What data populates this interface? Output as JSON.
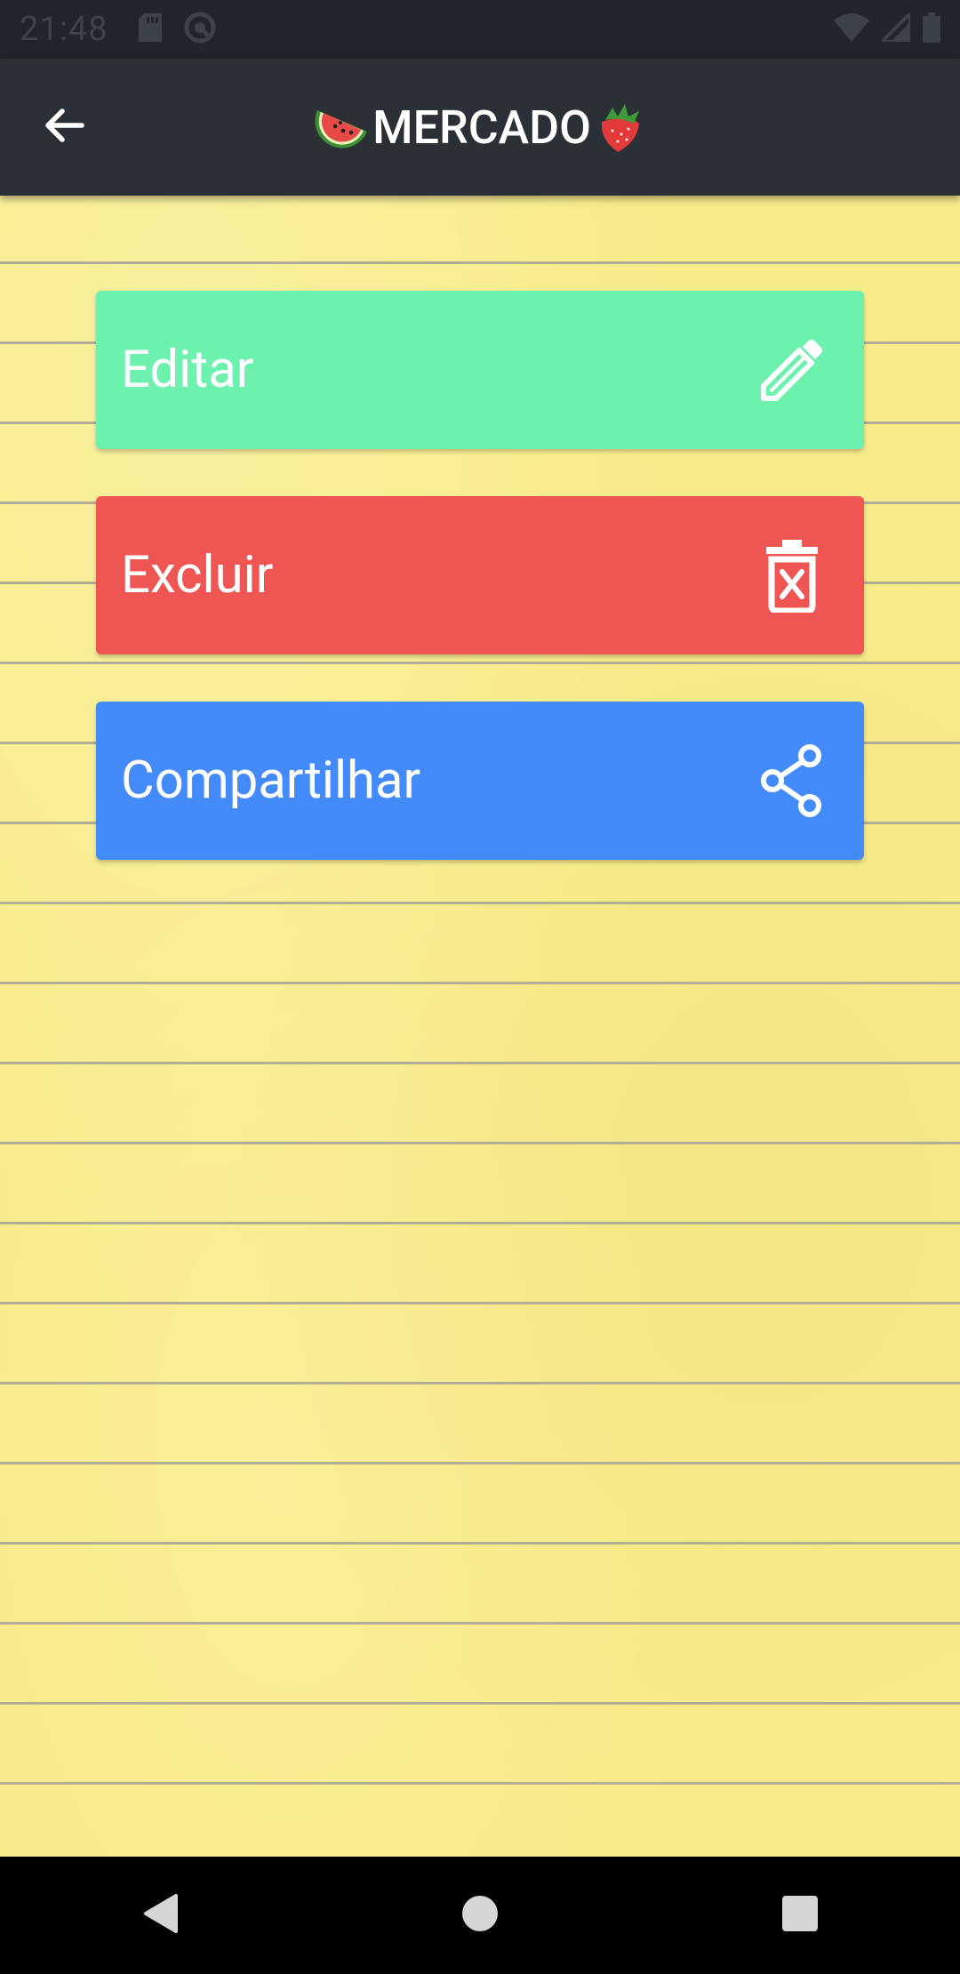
{
  "status_bar": {
    "time": "21:48",
    "icons": [
      "sd-card-icon",
      "sync-icon",
      "wifi-icon",
      "signal-icon",
      "battery-icon"
    ]
  },
  "app_bar": {
    "title": "MERCADO",
    "title_left_emoji": "watermelon-icon",
    "title_right_emoji": "strawberry-icon",
    "back_icon": "arrow-back-icon"
  },
  "actions": [
    {
      "label": "Editar",
      "icon": "pencil-icon",
      "color": "#6cf1ae"
    },
    {
      "label": "Excluir",
      "icon": "trash-x-icon",
      "color": "#ef5552"
    },
    {
      "label": "Compartilhar",
      "icon": "share-icon",
      "color": "#438bfb"
    }
  ],
  "nav_bar": {
    "icons": [
      "back-triangle-icon",
      "home-circle-icon",
      "recents-square-icon"
    ]
  },
  "colors": {
    "status_bar": "#1f252a",
    "app_bar": "#2a3036",
    "paper": "#f7ec8a",
    "rule_line": "#b3ad95"
  }
}
